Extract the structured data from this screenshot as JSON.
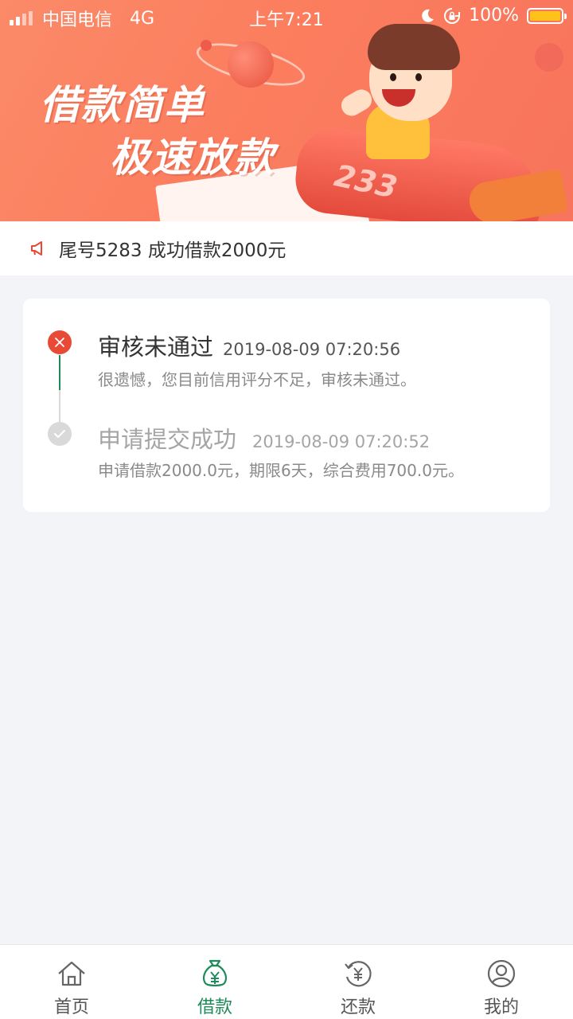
{
  "status_bar": {
    "carrier": "中国电信",
    "network": "4G",
    "time": "上午7:21",
    "battery": "100%",
    "battery_level": 1.0,
    "icons": [
      "signal-icon",
      "moon-icon",
      "rotation-lock-icon",
      "battery-icon"
    ]
  },
  "banner": {
    "slogan_line1": "借款简单",
    "slogan_line2": "极速放款",
    "rocket_number": "233"
  },
  "notice": {
    "icon": "megaphone-icon",
    "text": "尾号5283 成功借款2000元"
  },
  "timeline": [
    {
      "status": "rejected",
      "icon": "close-icon",
      "color": "#e84a35",
      "title": "审核未通过",
      "time": "2019-08-09 07:20:56",
      "desc": "很遗憾，您目前信用评分不足，审核未通过。"
    },
    {
      "status": "done",
      "icon": "check-icon",
      "color": "#d9d9d9",
      "title": "申请提交成功",
      "time": "2019-08-09 07:20:52",
      "desc": "申请借款2000.0元，期限6天，综合费用700.0元。"
    }
  ],
  "tabs": [
    {
      "label": "首页",
      "icon": "home-icon",
      "active": false
    },
    {
      "label": "借款",
      "icon": "money-bag-icon",
      "active": true
    },
    {
      "label": "还款",
      "icon": "repay-icon",
      "active": false
    },
    {
      "label": "我的",
      "icon": "profile-icon",
      "active": false
    }
  ],
  "colors": {
    "accent": "#1f8a5a",
    "error": "#e84a35",
    "banner": "#fb8a68",
    "background": "#f3f4f8"
  }
}
